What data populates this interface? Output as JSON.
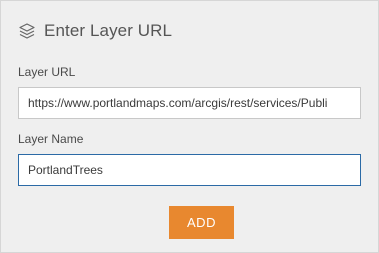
{
  "panel": {
    "title": "Enter Layer URL",
    "title_icon": "layers-icon"
  },
  "form": {
    "layer_url": {
      "label": "Layer URL",
      "value": "https://www.portlandmaps.com/arcgis/rest/services/Publi"
    },
    "layer_name": {
      "label": "Layer Name",
      "value": "PortlandTrees"
    },
    "add_button_label": "ADD"
  },
  "colors": {
    "panel_background": "#efefef",
    "accent_button": "#e8882f",
    "focus_border": "#2b6aa6"
  }
}
